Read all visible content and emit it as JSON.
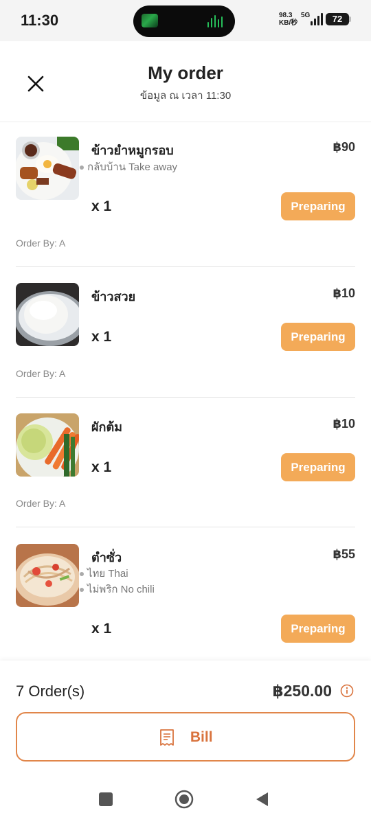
{
  "status_bar": {
    "time": "11:30",
    "net_speed_top": "98.3",
    "net_speed_unit": "KB/秒",
    "net_type": "5G",
    "battery": "72"
  },
  "header": {
    "title": "My order",
    "subtitle": "ข้อมูล ณ เวลา 11:30"
  },
  "orders": [
    {
      "name": "ข้าวยำหมูกรอบ",
      "price": "฿90",
      "options": [
        "กลับบ้าน Take away"
      ],
      "qty": "x 1",
      "status": "Preparing",
      "order_by": "Order By: A",
      "photo": "crispy-pork-rice-photo"
    },
    {
      "name": "ข้าวสวย",
      "price": "฿10",
      "options": [],
      "qty": "x 1",
      "status": "Preparing",
      "order_by": "Order By: A",
      "photo": "steamed-rice-photo"
    },
    {
      "name": "ผักต้ม",
      "price": "฿10",
      "options": [],
      "qty": "x 1",
      "status": "Preparing",
      "order_by": "Order By: A",
      "photo": "boiled-vegetables-photo"
    },
    {
      "name": "ตำซั่ว",
      "price": "฿55",
      "options": [
        "ไทย Thai",
        "ไม่พริก No chili"
      ],
      "qty": "x 1",
      "status": "Preparing",
      "order_by": "",
      "photo": "papaya-salad-photo"
    }
  ],
  "summary": {
    "order_count": "7 Order(s)",
    "total": "฿250.00",
    "bill_label": "Bill"
  },
  "colors": {
    "accent": "#f3aa58",
    "bill_accent": "#d9733d"
  },
  "icons": {
    "close": "close-icon",
    "info": "info-icon",
    "bill": "receipt-icon",
    "nav_recent": "recent-apps-icon",
    "nav_home": "home-icon",
    "nav_back": "back-icon"
  }
}
